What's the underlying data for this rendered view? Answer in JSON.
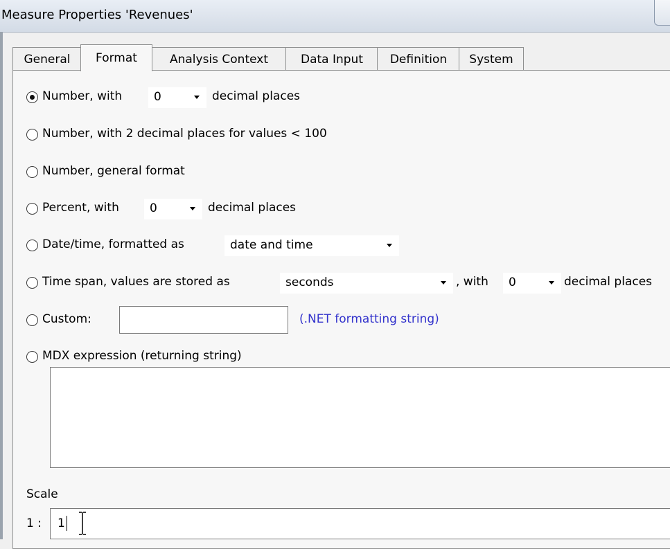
{
  "window": {
    "title": "Measure Properties 'Revenues'"
  },
  "tabs": [
    {
      "label": "General",
      "active": false
    },
    {
      "label": "Format",
      "active": true
    },
    {
      "label": "Analysis Context",
      "active": false
    },
    {
      "label": "Data Input",
      "active": false
    },
    {
      "label": "Definition",
      "active": false
    },
    {
      "label": "System",
      "active": false
    }
  ],
  "format": {
    "number": {
      "label_prefix": "Number, with",
      "decimals": "0",
      "label_suffix": "decimal places",
      "selected": true
    },
    "number_small": {
      "label": "Number, with 2 decimal places for values < 100",
      "selected": false
    },
    "number_general": {
      "label": "Number, general format",
      "selected": false
    },
    "percent": {
      "label_prefix": "Percent, with",
      "decimals": "0",
      "label_suffix": "decimal places",
      "selected": false
    },
    "datetime": {
      "label_prefix": "Date/time, formatted as",
      "format": "date and time",
      "selected": false
    },
    "timespan": {
      "label_prefix": "Time span, values are stored as",
      "unit": "seconds",
      "label_mid": ", with",
      "decimals": "0",
      "label_suffix": "decimal places",
      "selected": false
    },
    "custom": {
      "label": "Custom:",
      "value": "",
      "hint": "(.NET formatting string)",
      "selected": false
    },
    "mdx": {
      "label": "MDX expression (returning string)",
      "value": "",
      "selected": false
    },
    "scale": {
      "label": "Scale",
      "prefix": "1 :",
      "value": "1"
    }
  },
  "colors": {
    "hint_text": "#3333cc",
    "panel_bg": "#f7f7f7",
    "window_bg": "#f0f0f0"
  }
}
